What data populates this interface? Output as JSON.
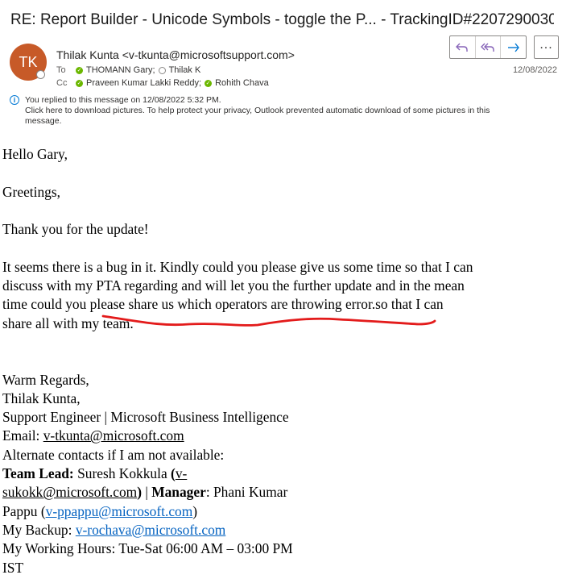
{
  "subject": "RE: Report Builder - Unicode Symbols - toggle the P... - TrackingID#2207290030...",
  "sender": {
    "initials": "TK",
    "display": "Thilak Kunta <v-tkunta@microsoftsupport.com>",
    "avatar_color": "#c75a28"
  },
  "to": {
    "label": "To",
    "recipients": [
      "THOMANN Gary;",
      "Thilak K"
    ]
  },
  "cc": {
    "label": "Cc",
    "recipients": [
      "Praveen Kumar Lakki Reddy;",
      "Rohith Chava"
    ]
  },
  "date": "12/08/2022",
  "actions": {
    "reply_icon": "reply-icon",
    "reply_all_icon": "reply-all-icon",
    "forward_icon": "forward-icon",
    "more_label": "..."
  },
  "notice": {
    "replied": "You replied to this message on 12/08/2022 5:32 PM.",
    "download_line1": "Click here to download pictures. To help protect your privacy, Outlook prevented automatic download of some pictures in this",
    "download_line2": "message."
  },
  "message": {
    "greeting": "Hello Gary,",
    "greetings": "Greetings,",
    "thanks": "Thank you for the update!",
    "para_l1": "It seems  there is a bug in it. Kindly could you please give us some time so that I can",
    "para_l2": "discuss with my PTA regarding and will let you the further update and in the mean",
    "para_l3": "time could you please share us which operators are throwing error.so that I can",
    "para_l4": "share all with my team.",
    "regards": "Warm Regards,",
    "name": "Thilak Kunta,",
    "title": "Support Engineer | Microsoft Business Intelligence",
    "email_label": "Email: ",
    "email": "v-tkunta@microsoft.com",
    "alternate": "Alternate contacts if I am not available:",
    "team_lead_label": "Team Lead:",
    "team_lead_name": " Suresh Kokkula ",
    "open_paren": "(",
    "team_lead_email_l1": "v-",
    "team_lead_email_l2": "sukokk@microsoft.com",
    "close_paren": ")",
    "sep": " | ",
    "manager_label": "Manager",
    "manager_rest": ": Phani Kumar",
    "manager_l2": "Pappu (",
    "manager_email": "v-ppappu@microsoft.com",
    "manager_end": ")",
    "backup_label": "My Backup: ",
    "backup_email": "v-rochava@microsoft.com",
    "hours": "My Working Hours: Tue-Sat 06:00 AM – 03:00 PM",
    "tz": "IST"
  },
  "annotation_color": "#e31b1b"
}
